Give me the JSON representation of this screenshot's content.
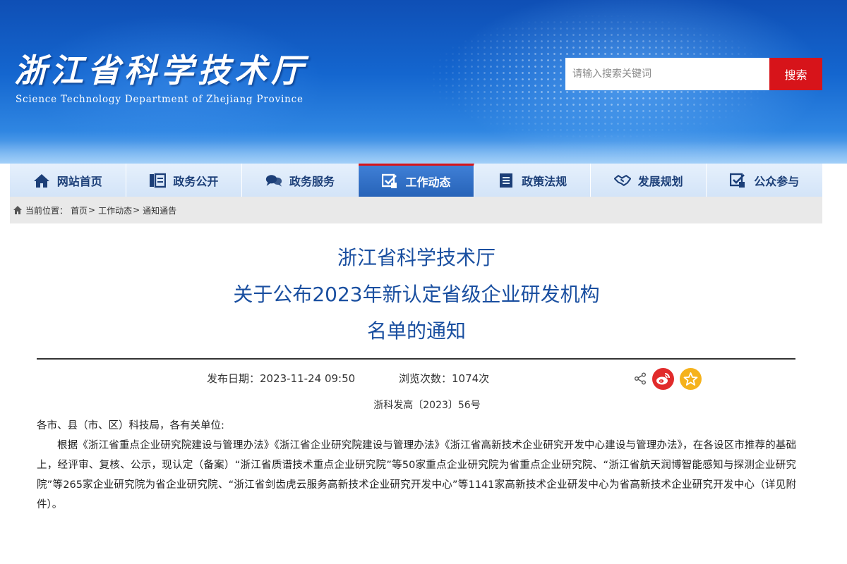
{
  "header": {
    "logo_cn": "浙江省科学技术厅",
    "logo_en": "Science Technology Department of Zhejiang Province",
    "search_placeholder": "请输入搜索关键词",
    "search_button": "搜索"
  },
  "nav": {
    "items": [
      {
        "label": "网站首页",
        "icon": "home-icon"
      },
      {
        "label": "政务公开",
        "icon": "document-list-icon"
      },
      {
        "label": "政务服务",
        "icon": "chat-bubbles-icon"
      },
      {
        "label": "工作动态",
        "icon": "work-news-icon",
        "active": true
      },
      {
        "label": "政策法规",
        "icon": "list-icon"
      },
      {
        "label": "发展规划",
        "icon": "handshake-icon"
      },
      {
        "label": "公众参与",
        "icon": "participation-icon"
      }
    ]
  },
  "breadcrumb": {
    "prefix": "当前位置：",
    "items": [
      "首页",
      "工作动态",
      "通知通告"
    ],
    "separator": ">"
  },
  "article": {
    "title_lines": [
      "浙江省科学技术厅",
      "关于公布2023年新认定省级企业研发机构",
      "名单的通知"
    ],
    "date_label": "发布日期：2023-11-24 09:50",
    "views_label": "浏览次数：1074次",
    "doc_number": "浙科发高〔2023〕56号",
    "salutation": "各市、县（市、区）科技局，各有关单位:",
    "paragraph": "根据《浙江省重点企业研究院建设与管理办法》《浙江省企业研究院建设与管理办法》《浙江省高新技术企业研究开发中心建设与管理办法》，在各设区市推荐的基础上，经评审、复核、公示，现认定（备案）“浙江省质谱技术重点企业研究院”等50家重点企业研究院为省重点企业研究院、“浙江省航天润博智能感知与探测企业研究院”等265家企业研究院为省企业研究院、“浙江省剑齿虎云服务高新技术企业研究开发中心”等1141家高新技术企业研发中心为省高新技术企业研究开发中心（详见附件）。"
  },
  "colors": {
    "accent_red": "#d7141a",
    "title_blue": "#1a4fa0",
    "nav_active": "#2763b8"
  }
}
